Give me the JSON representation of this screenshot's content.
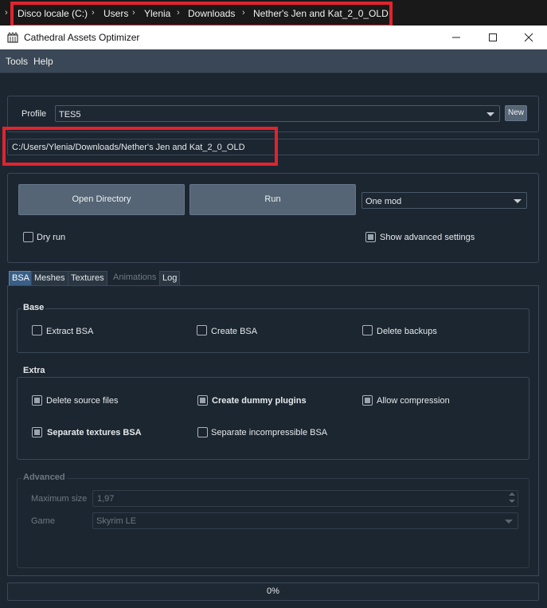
{
  "breadcrumb": {
    "items": [
      "Disco locale (C:)",
      "Users",
      "Ylenia",
      "Downloads",
      "Nether's Jen and Kat_2_0_OLD"
    ]
  },
  "window": {
    "title": "Cathedral Assets Optimizer"
  },
  "menu": {
    "items": [
      "Tools",
      "Help"
    ]
  },
  "profile": {
    "label": "Profile",
    "value": "TES5",
    "new_label": "New"
  },
  "path": {
    "value": "C:/Users/Ylenia/Downloads/Nether's Jen and Kat_2_0_OLD"
  },
  "actions": {
    "open_directory": "Open Directory",
    "run": "Run",
    "mode": "One mod",
    "dry_run": "Dry run",
    "show_advanced": "Show advanced settings"
  },
  "tabs": [
    "BSA",
    "Meshes",
    "Textures",
    "Animations",
    "Log"
  ],
  "base": {
    "title": "Base",
    "extract_bsa": "Extract BSA",
    "create_bsa": "Create BSA",
    "delete_backups": "Delete backups"
  },
  "extra": {
    "title": "Extra",
    "delete_source": "Delete source files",
    "create_dummy": "Create dummy plugins",
    "allow_compression": "Allow compression",
    "separate_textures": "Separate textures BSA",
    "separate_incompressible": "Separate incompressible BSA"
  },
  "advanced": {
    "title": "Advanced",
    "max_size_label": "Maximum size",
    "max_size_value": "1,97",
    "game_label": "Game",
    "game_value": "Skyrim LE"
  },
  "progress": {
    "text": "0%",
    "value": 0
  },
  "colors": {
    "background": "#1c2631",
    "highlight_box": "#e0242e",
    "button": "#566575",
    "menubar": "#3a4756"
  },
  "icons": {
    "app": "cathedral-icon",
    "minimize": "minimize-icon",
    "maximize": "maximize-icon",
    "close": "close-icon"
  }
}
